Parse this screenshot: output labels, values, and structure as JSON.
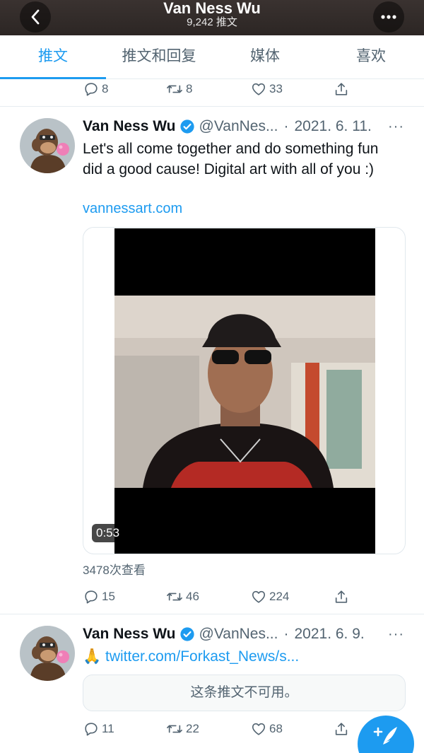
{
  "header": {
    "title": "Van Ness Wu",
    "subtitle": "9,242 推文",
    "back_icon": "chevron-left-icon",
    "more_icon": "more-horizontal-icon"
  },
  "tabs": [
    {
      "label": "推文",
      "active": true
    },
    {
      "label": "推文和回复",
      "active": false
    },
    {
      "label": "媒体",
      "active": false
    },
    {
      "label": "喜欢",
      "active": false
    }
  ],
  "prev_tweet": {
    "replies": "8",
    "retweets": "8",
    "likes": "33"
  },
  "tweet1": {
    "name": "Van Ness Wu",
    "handle": "@VanNes...",
    "separator": "·",
    "date": "2021. 6. 11.",
    "more": "···",
    "text": "Let's all come together and do something fun did a good cause! Digital art with all of you :)",
    "link": "vannessart.com",
    "video_duration": "0:53",
    "views": "3478次查看",
    "replies": "15",
    "retweets": "46",
    "likes": "224"
  },
  "tweet2": {
    "name": "Van Ness Wu",
    "handle": "@VanNes...",
    "separator": "·",
    "date": "2021. 6. 9.",
    "more": "···",
    "emoji": "🙏",
    "link": "twitter.com/Forkast_News/s...",
    "unavailable": "这条推文不可用。",
    "replies": "11",
    "retweets": "22",
    "likes": "68"
  },
  "colors": {
    "accent": "#1d9bf0",
    "text_secondary": "#536471",
    "header_bg": "#2f2927"
  },
  "compose_icon": "feather-plus-icon"
}
